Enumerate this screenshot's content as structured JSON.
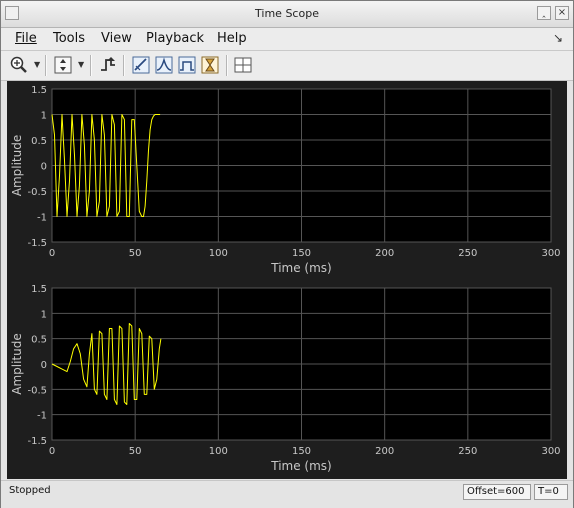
{
  "window": {
    "title": "Time Scope"
  },
  "menu": [
    "File",
    "Tools",
    "View",
    "Playback",
    "Help"
  ],
  "toolbar": {
    "icons": [
      "zoom-in-icon",
      "dropdown-arrow-icon",
      "autoscale-icon",
      "dropdown-arrow-icon",
      "trigger-icon",
      "cursor-measurements-icon",
      "peak-finder-icon",
      "signal-statistics-icon",
      "bilevel-measurements-icon",
      "layout-grid-icon"
    ]
  },
  "axes_style": {
    "background": "#000000",
    "grid": "#555555",
    "text": "#c8c8c8",
    "line": "#ffff00"
  },
  "chart_data": [
    {
      "type": "line",
      "title": "",
      "xlabel": "Time (ms)",
      "ylabel": "Amplitude",
      "xlim": [
        0,
        300
      ],
      "ylim": [
        -1.5,
        1.5
      ],
      "xticks": [
        "0",
        "50",
        "100",
        "150",
        "200",
        "250",
        "300"
      ],
      "yticks": [
        "1.5",
        "1",
        "0.5",
        "0",
        "-0.5",
        "-1",
        "-1.5"
      ],
      "grid": true,
      "series": [
        {
          "color": "#ffff00",
          "x": [
            0,
            1.5,
            3,
            4.5,
            6,
            7.5,
            9,
            10.5,
            12,
            13.5,
            15,
            16.5,
            18,
            19.5,
            21,
            22.5,
            24,
            25.5,
            27,
            28.5,
            30,
            31.5,
            33,
            34.5,
            36,
            37.5,
            39,
            40.5,
            42,
            43.5,
            45,
            46.5,
            48,
            49.5,
            51,
            52.5,
            54,
            55,
            56,
            57,
            58,
            59,
            60,
            61,
            62,
            63,
            64,
            65
          ],
          "y": [
            1,
            0.6,
            -1,
            -0.2,
            1,
            0.1,
            -1,
            -0.3,
            1,
            0.2,
            -1,
            -0.4,
            1,
            0.4,
            -1,
            -0.5,
            1,
            0.5,
            -1,
            -0.7,
            1,
            0.6,
            -1,
            -0.8,
            1,
            0.8,
            -1,
            -0.9,
            1,
            0.9,
            -1,
            -1,
            0.9,
            0.9,
            0,
            -0.9,
            -1,
            -1,
            -0.8,
            -0.3,
            0.3,
            0.7,
            0.9,
            0.97,
            1,
            1,
            1,
            1
          ]
        }
      ]
    },
    {
      "type": "line",
      "title": "",
      "xlabel": "Time (ms)",
      "ylabel": "Amplitude",
      "xlim": [
        0,
        300
      ],
      "ylim": [
        -1.5,
        1.5
      ],
      "xticks": [
        "0",
        "50",
        "100",
        "150",
        "200",
        "250",
        "300"
      ],
      "yticks": [
        "1.5",
        "1",
        "0.5",
        "0",
        "-0.5",
        "-1",
        "-1.5"
      ],
      "grid": true,
      "series": [
        {
          "color": "#ffff00",
          "x": [
            0,
            3,
            6,
            9,
            11,
            13,
            15,
            17,
            19,
            21,
            22.5,
            24,
            25.5,
            27,
            28.5,
            30,
            31.5,
            33,
            34.5,
            36,
            37.5,
            39,
            40.5,
            42,
            43.5,
            45,
            46.5,
            48,
            49.5,
            51,
            52.5,
            54,
            55.5,
            57,
            58.5,
            60,
            61.5,
            63,
            64.5,
            65.5
          ],
          "y": [
            0,
            -0.05,
            -0.1,
            -0.15,
            0.05,
            0.3,
            0.4,
            0.2,
            -0.3,
            -0.45,
            0.2,
            0.6,
            -0.5,
            -0.6,
            0.65,
            0.6,
            -0.6,
            -0.7,
            0.7,
            0.7,
            -0.7,
            -0.8,
            0.75,
            0.7,
            -0.75,
            -0.8,
            0.8,
            0.75,
            -0.7,
            -0.7,
            0.7,
            0.6,
            -0.6,
            -0.6,
            0.55,
            0.5,
            -0.5,
            -0.3,
            0.3,
            0.5
          ]
        }
      ]
    }
  ],
  "status": {
    "state": "Stopped",
    "offset": "Offset=600",
    "time": "T=0"
  }
}
